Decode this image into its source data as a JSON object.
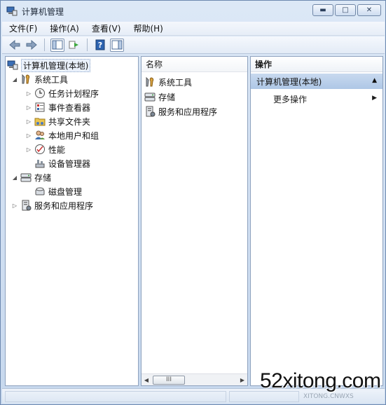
{
  "window": {
    "title": "计算机管理",
    "controls": {
      "minimize": "▬",
      "maximize": "□",
      "close": "✕"
    }
  },
  "menu": [
    "文件(F)",
    "操作(A)",
    "查看(V)",
    "帮助(H)"
  ],
  "toolbar": [
    "back-arrow-icon",
    "forward-arrow-icon",
    "show-hide-console-tree-icon",
    "export-list-icon",
    "help-icon",
    "show-hide-action-pane-icon"
  ],
  "tree": {
    "root": "计算机管理(本地)",
    "system_tools": "系统工具",
    "task_scheduler": "任务计划程序",
    "event_viewer": "事件查看器",
    "shared_folders": "共享文件夹",
    "local_users": "本地用户和组",
    "performance": "性能",
    "device_manager": "设备管理器",
    "storage": "存储",
    "disk_management": "磁盘管理",
    "services_apps": "服务和应用程序"
  },
  "list": {
    "header": "名称",
    "items": [
      "系统工具",
      "存储",
      "服务和应用程序"
    ],
    "scroll_thumb": "III"
  },
  "actions": {
    "header": "操作",
    "group": "计算机管理(本地)",
    "more": "更多操作"
  },
  "watermark": "52xitong.com",
  "watermark_sub": "XITONG.CNWXS"
}
